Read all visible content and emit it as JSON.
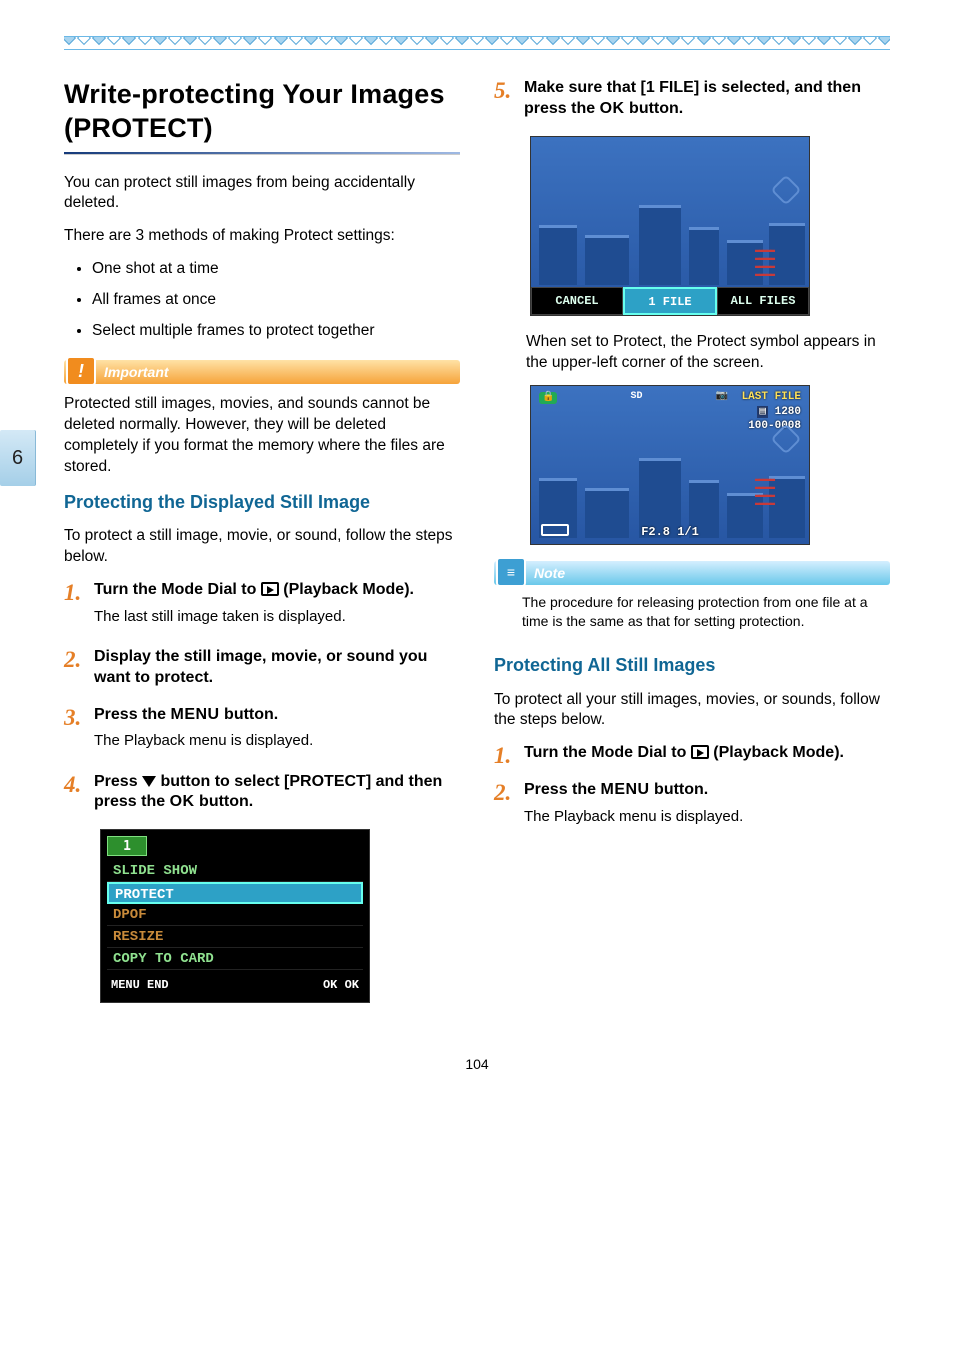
{
  "page_number": "104",
  "section_tab": "6",
  "title": "Write-protecting Your Images (PROTECT)",
  "intro_p1": "You can protect still images from being accidentally deleted.",
  "intro_p2": "There are 3 methods of making Protect settings:",
  "methods": [
    "One shot at a time",
    "All frames at once",
    "Select multiple frames to protect together"
  ],
  "important_label": "Important",
  "important_text": "Protected still images, movies, and sounds cannot be deleted normally. However, they will be deleted completely if you format the memory where the files are stored.",
  "subhead1": "Protecting the Displayed Still Image",
  "subhead1_intro": "To protect a still image, movie, or sound, follow the steps below.",
  "steps_left": {
    "s1": {
      "num": "1.",
      "title_a": "Turn the Mode Dial to ",
      "title_b": " (Playback Mode).",
      "desc": "The last still image taken is displayed."
    },
    "s2": {
      "num": "2.",
      "title": "Display the still image, movie, or sound you want to protect."
    },
    "s3": {
      "num": "3.",
      "title_a": "Press the ",
      "menu": "MENU",
      "title_b": " button.",
      "desc": "The Playback menu is displayed."
    },
    "s4": {
      "num": "4.",
      "title_a": "Press ",
      "title_b": " button to select [PROTECT] and then press the ",
      "ok": "OK",
      "title_c": " button."
    }
  },
  "menu_shot": {
    "tab": "1",
    "rows": [
      "SLIDE SHOW",
      "PROTECT",
      "DPOF",
      "RESIZE",
      "COPY TO CARD"
    ],
    "selected_index": 1,
    "bottom_left": "MENU END",
    "bottom_right": "OK OK"
  },
  "steps_right": {
    "s5": {
      "num": "5.",
      "title_a": "Make sure that [1 FILE] is selected, and then press the ",
      "ok": "OK",
      "title_b": " button."
    },
    "s5_desc": "When set to Protect, the Protect symbol appears in the upper-left corner of the screen."
  },
  "city_shot1": {
    "opts": [
      "CANCEL",
      "1 FILE",
      "ALL FILES"
    ],
    "selected": 1
  },
  "city_shot2": {
    "top_right": [
      "LAST FILE",
      "1280",
      "100-0008"
    ],
    "bottom": "F2.8 1/1"
  },
  "note_label": "Note",
  "note_text": "The procedure for releasing protection from one file at a time is the same as that for setting protection.",
  "subhead2": "Protecting All Still Images",
  "subhead2_intro": "To protect all your still images, movies, or sounds, follow the steps below.",
  "steps_right2": {
    "s1": {
      "num": "1.",
      "title_a": "Turn the Mode Dial to ",
      "title_b": " (Playback Mode)."
    },
    "s2": {
      "num": "2.",
      "title_a": "Press the ",
      "menu": "MENU",
      "title_b": " button.",
      "desc": "The Playback menu is displayed."
    }
  }
}
